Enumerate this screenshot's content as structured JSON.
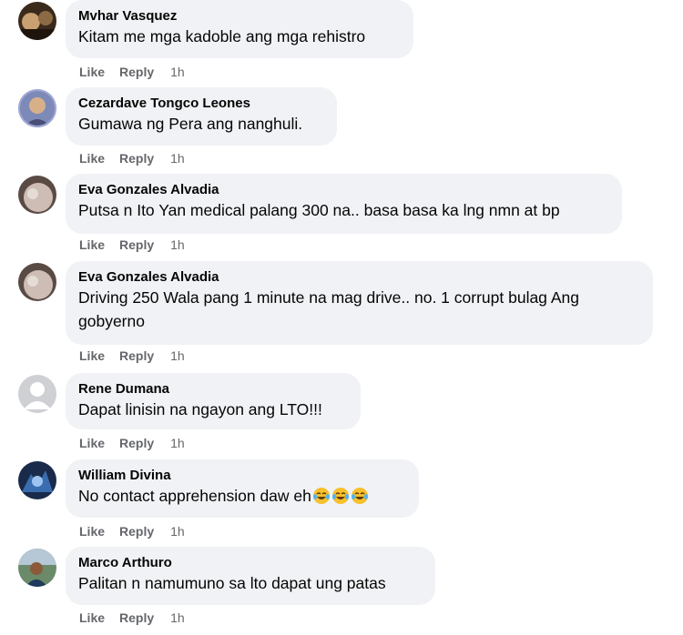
{
  "like_label": "Like",
  "reply_label": "Reply",
  "comments": [
    {
      "author": "Mvhar Vasquez",
      "text": "Kitam me mga kadoble ang mga rehistro",
      "time": "1h"
    },
    {
      "author": "Cezardave Tongco Leones",
      "text": "Gumawa ng Pera ang nanghuli.",
      "time": "1h"
    },
    {
      "author": "Eva Gonzales Alvadia",
      "text": "Putsa n Ito Yan medical palang 300 na.. basa basa ka lng nmn at bp",
      "time": "1h"
    },
    {
      "author": "Eva Gonzales Alvadia",
      "text": "Driving 250 Wala pang 1 minute na mag drive.. no. 1 corrupt bulag Ang gobyerno",
      "time": "1h"
    },
    {
      "author": "Rene Dumana",
      "text": "Dapat linisin na ngayon ang LTO!!!",
      "time": "1h"
    },
    {
      "author": "William Divina",
      "text": "No contact apprehension daw eh",
      "emoji": [
        "laughing-crying-emoji",
        "laughing-crying-emoji",
        "laughing-crying-emoji"
      ],
      "time": "1h"
    },
    {
      "author": "Marco Arthuro",
      "text": "Palitan n namumuno sa lto dapat ung patas",
      "time": "1h"
    }
  ]
}
